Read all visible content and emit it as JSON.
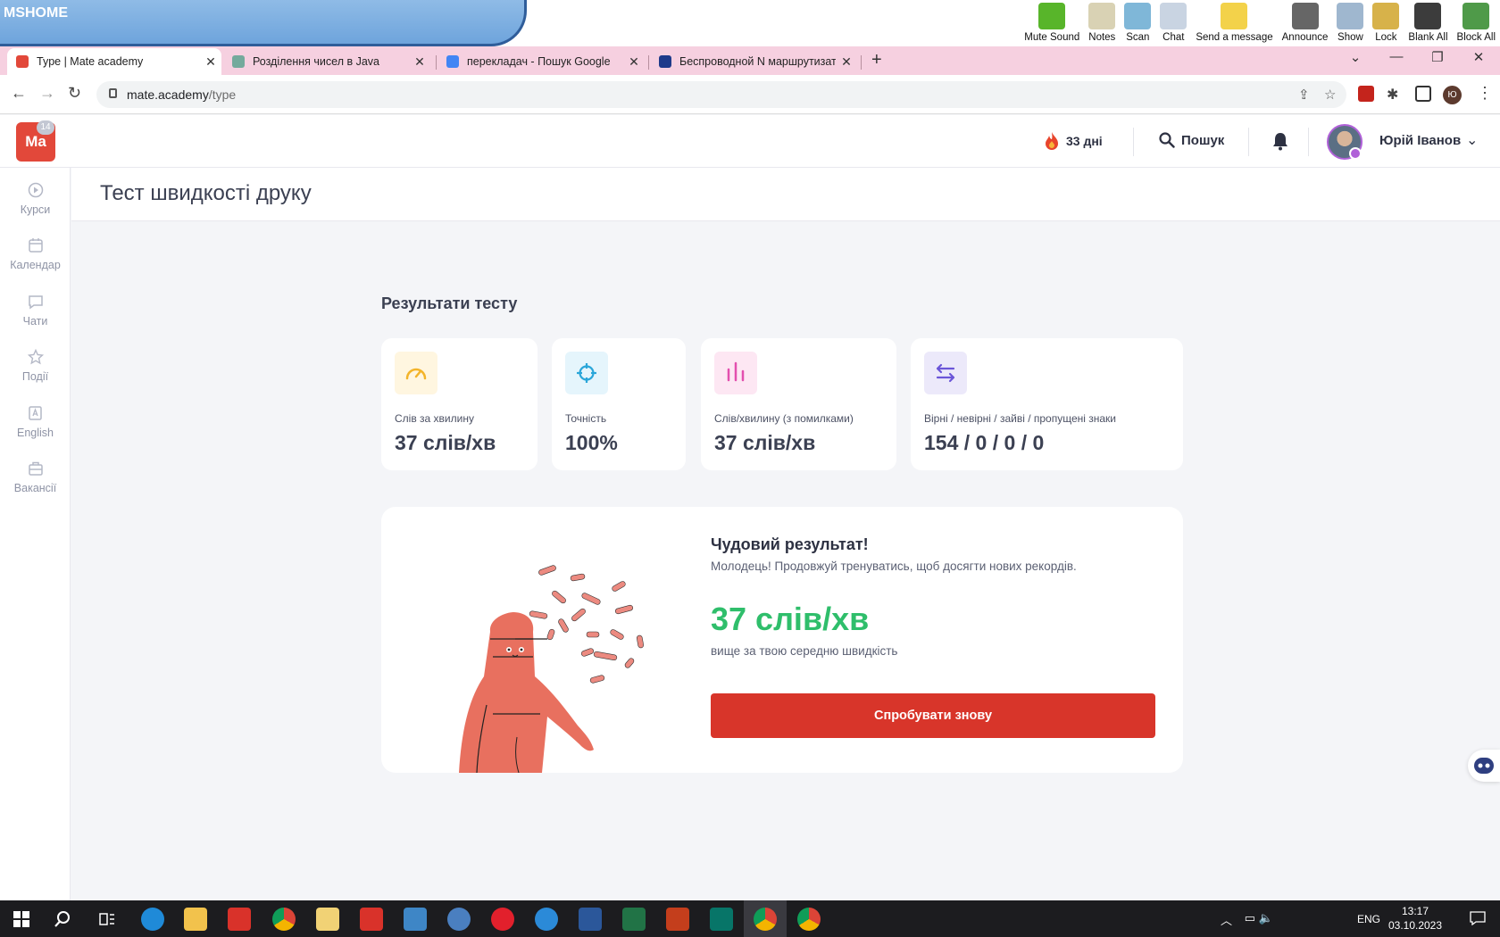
{
  "mshome": {
    "title": "MSHOME",
    "tools": [
      {
        "label": "Mute Sound",
        "icon": "speaker-icon",
        "color": "#58b52a"
      },
      {
        "label": "Notes",
        "icon": "notes-icon",
        "color": "#d9d2b4"
      },
      {
        "label": "Scan",
        "icon": "scan-icon",
        "color": "#7fb7d8"
      },
      {
        "label": "Chat",
        "icon": "chat-icon",
        "color": "#c9d4e2"
      },
      {
        "label": "Send a message",
        "icon": "message-icon",
        "color": "#f3d24a"
      },
      {
        "label": "Announce",
        "icon": "megaphone-icon",
        "color": "#666666"
      },
      {
        "label": "Show",
        "icon": "presentation-icon",
        "color": "#9fb7cf"
      },
      {
        "label": "Lock",
        "icon": "lock-icon",
        "color": "#d7b24a"
      },
      {
        "label": "Blank All",
        "icon": "monitor-icon",
        "color": "#3c3c3c"
      },
      {
        "label": "Block All",
        "icon": "globe-icon",
        "color": "#4f9a49"
      }
    ]
  },
  "browser": {
    "tabs": [
      {
        "title": "Type | Mate academy",
        "favicon_color": "#e2483a",
        "active": true
      },
      {
        "title": "Розділення чисел в Java",
        "favicon_color": "#74aa9c",
        "active": false
      },
      {
        "title": "перекладач - Пошук Google",
        "favicon_color": "#4285f4",
        "active": false
      },
      {
        "title": "Беспроводной N маршрутизатор",
        "favicon_color": "#1e3a8a",
        "active": false
      }
    ],
    "url_host": "mate.academy",
    "url_path": "/type"
  },
  "header": {
    "logo": "Ma",
    "streak": "33 дні",
    "search_label": "Пошук",
    "user_name": "Юрій Іванов"
  },
  "sidebar": {
    "items": [
      {
        "label": "Курси",
        "icon": "play-circle-icon"
      },
      {
        "label": "Календар",
        "icon": "calendar-icon"
      },
      {
        "label": "Чати",
        "icon": "chat-bubble-icon"
      },
      {
        "label": "Події",
        "icon": "star-icon"
      },
      {
        "label": "English",
        "icon": "english-book-icon"
      },
      {
        "label": "Вакансії",
        "icon": "briefcase-icon"
      }
    ],
    "chat_badge": "14"
  },
  "page": {
    "title": "Тест швидкості друку",
    "results_heading": "Результати тесту",
    "stats": [
      {
        "label": "Слів за хвилину",
        "value": "37 слів/хв",
        "icon": "speedometer-icon",
        "bg": "#fff6e0",
        "color": "#f3b42a"
      },
      {
        "label": "Точність",
        "value": "100%",
        "icon": "crosshair-icon",
        "bg": "#e5f5fc",
        "color": "#2aa6d9"
      },
      {
        "label": "Слів/хвилину (з помилками)",
        "value": "37 слів/хв",
        "icon": "bar-chart-icon",
        "bg": "#fde7f3",
        "color": "#e34fae"
      },
      {
        "label": "Вірні / невірні / зайві / пропущені знаки",
        "value": "154 / 0 / 0 / 0",
        "icon": "arrows-swap-icon",
        "bg": "#ece9fa",
        "color": "#6b56d8"
      }
    ],
    "result": {
      "title": "Чудовий результат!",
      "subtitle": "Молодець! Продовжуй тренуватись, щоб досягти нових рекордів.",
      "speed": "37 слів/хв",
      "note": "вище за твою середню швидкість",
      "retry_label": "Спробувати знову"
    }
  },
  "taskbar": {
    "lang": "ENG",
    "time": "13:17",
    "date": "03.10.2023"
  }
}
